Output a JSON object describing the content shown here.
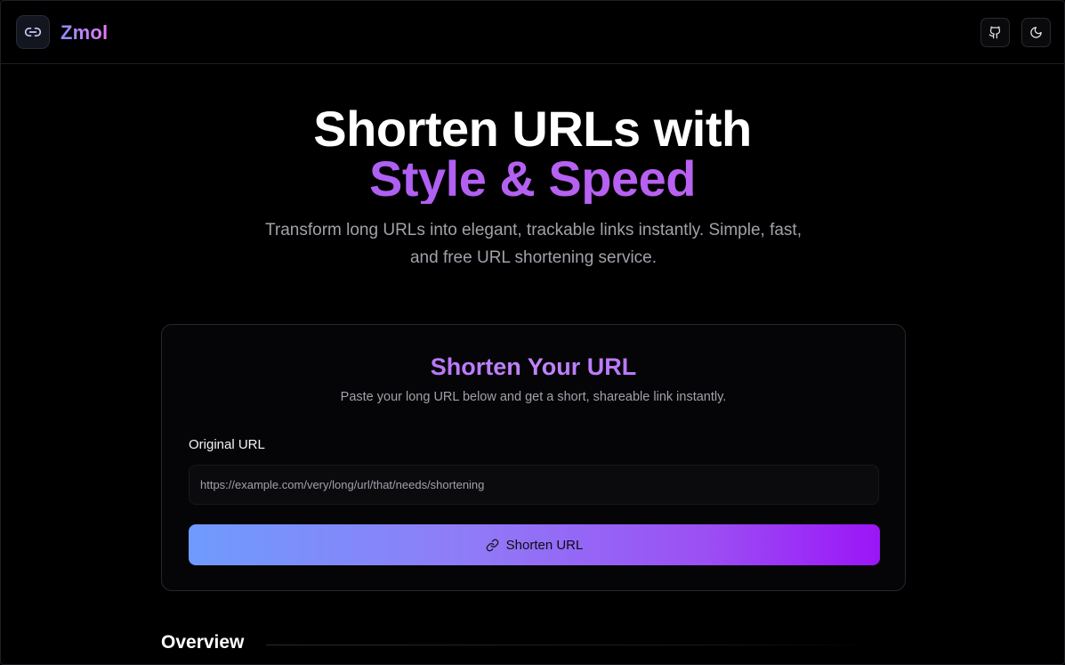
{
  "header": {
    "brand": "Zmol",
    "icons": {
      "logo": "link-icon",
      "github": "github-icon",
      "theme": "moon-icon"
    }
  },
  "hero": {
    "title_line1": "Shorten URLs with",
    "title_line2": "Style & Speed",
    "subtitle": "Transform long URLs into elegant, trackable links instantly. Simple, fast, and free URL shortening service."
  },
  "card": {
    "title": "Shorten Your URL",
    "subtitle": "Paste your long URL below and get a short, shareable link instantly.",
    "field_label": "Original URL",
    "input_value": "",
    "input_placeholder": "https://example.com/very/long/url/that/needs/shortening",
    "button_label": "Shorten URL",
    "button_icon": "link-icon"
  },
  "overview": {
    "heading": "Overview"
  },
  "colors": {
    "background": "#000000",
    "accent_purple": "#a855f7",
    "button_gradient_start": "#6f9bfd",
    "button_gradient_end": "#9b15f7",
    "muted_text": "#a1a1aa"
  }
}
